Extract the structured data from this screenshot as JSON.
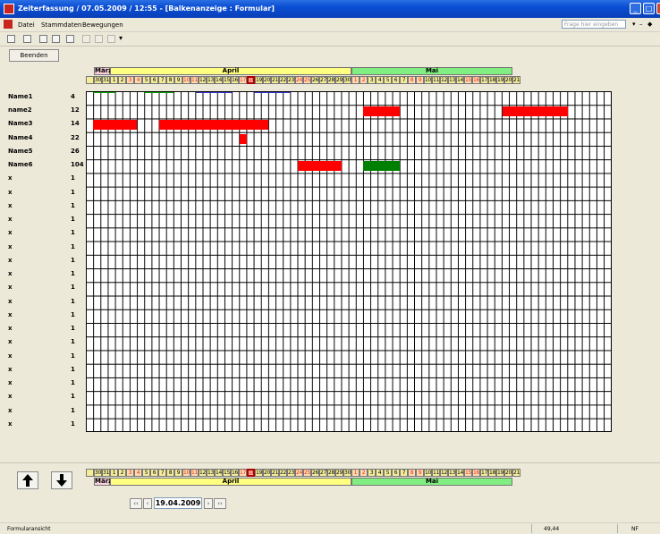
{
  "window": {
    "title": "Zeiterfassung / 07.05.2009 / 12:55 - [Balkenanzeige : Formular]"
  },
  "menu": {
    "items": [
      "Datei",
      "Stammdaten",
      "Bewegungen"
    ],
    "help_placeholder": "Frage hier eingeben"
  },
  "toolbar": {
    "icons": [
      "design-view-icon",
      "form-view-icon",
      "print-icon",
      "print-preview-icon",
      "save-icon",
      "cut-icon",
      "copy-icon",
      "paste-icon"
    ]
  },
  "buttons": {
    "beenden": "Beenden"
  },
  "calendar": {
    "months": [
      {
        "name": "März",
        "color": "#f9d0db",
        "span": 2
      },
      {
        "name": "April",
        "color": "#ffff80",
        "span": 30
      },
      {
        "name": "Mai",
        "color": "#80ee80",
        "span": 20
      }
    ],
    "days": [
      "",
      "30",
      "31",
      "1",
      "2",
      "3",
      "4",
      "5",
      "6",
      "7",
      "8",
      "9",
      "10",
      "11",
      "12",
      "13",
      "14",
      "15",
      "16",
      "17",
      "18",
      "19",
      "20",
      "21",
      "22",
      "23",
      "24",
      "25",
      "26",
      "27",
      "28",
      "29",
      "30",
      "1",
      "2",
      "3",
      "4",
      "5",
      "6",
      "7",
      "8",
      "9",
      "10",
      "11",
      "12",
      "13",
      "14",
      "15",
      "16",
      "17",
      "18",
      "19",
      "20",
      "21"
    ],
    "weekend_day_indices": [
      5,
      6,
      12,
      13,
      19,
      20,
      26,
      27,
      33,
      34,
      40,
      41,
      47,
      48
    ],
    "today_index": 20,
    "colors": {
      "weekday": "#f5ec9a",
      "weekend": "#ffd9b0",
      "weekend_text": "#e0301e",
      "today_border": "#b00000"
    }
  },
  "rows": [
    {
      "name": "Name1",
      "count": "4"
    },
    {
      "name": "name2",
      "count": "12"
    },
    {
      "name": "Name3",
      "count": "14"
    },
    {
      "name": "Name4",
      "count": "22"
    },
    {
      "name": "Name5",
      "count": "26"
    },
    {
      "name": "Name6",
      "count": "104"
    },
    {
      "name": "x",
      "count": "1"
    },
    {
      "name": "x",
      "count": "1"
    },
    {
      "name": "x",
      "count": "1"
    },
    {
      "name": "x",
      "count": "1"
    },
    {
      "name": "x",
      "count": "1"
    },
    {
      "name": "x",
      "count": "1"
    },
    {
      "name": "x",
      "count": "1"
    },
    {
      "name": "x",
      "count": "1"
    },
    {
      "name": "x",
      "count": "1"
    },
    {
      "name": "x",
      "count": "1"
    },
    {
      "name": "x",
      "count": "1"
    },
    {
      "name": "x",
      "count": "1"
    },
    {
      "name": "x",
      "count": "1"
    },
    {
      "name": "x",
      "count": "1"
    },
    {
      "name": "x",
      "count": "1"
    },
    {
      "name": "x",
      "count": "1"
    },
    {
      "name": "x",
      "count": "1"
    },
    {
      "name": "x",
      "count": "1"
    },
    {
      "name": "x",
      "count": "1"
    }
  ],
  "bars": [
    {
      "row": 1,
      "start": 38,
      "end": 43,
      "color": "#ff0000"
    },
    {
      "row": 1,
      "start": 57,
      "end": 66,
      "color": "#ff0000"
    },
    {
      "row": 2,
      "start": 1,
      "end": 7,
      "color": "#ff0000"
    },
    {
      "row": 2,
      "start": 10,
      "end": 25,
      "color": "#ff0000"
    },
    {
      "row": 3,
      "start": 21,
      "end": 22,
      "color": "#ff0000"
    },
    {
      "row": 5,
      "start": 29,
      "end": 35,
      "color": "#ff0000"
    },
    {
      "row": 5,
      "start": 38,
      "end": 43,
      "color": "#008000"
    }
  ],
  "row_toplines": [
    {
      "row": 0,
      "start": 1,
      "end": 4,
      "color": "#00a000"
    },
    {
      "row": 0,
      "start": 8,
      "end": 12,
      "color": "#00a000"
    },
    {
      "row": 0,
      "start": 15,
      "end": 20,
      "color": "#3333cc"
    },
    {
      "row": 0,
      "start": 23,
      "end": 28,
      "color": "#3333cc"
    }
  ],
  "navigation": {
    "date": "19.04.2009",
    "first": "‹‹",
    "prev": "‹",
    "next": "›",
    "last": "››"
  },
  "status": {
    "left": "Formularansicht",
    "value": "49,44",
    "mode": "NF"
  }
}
